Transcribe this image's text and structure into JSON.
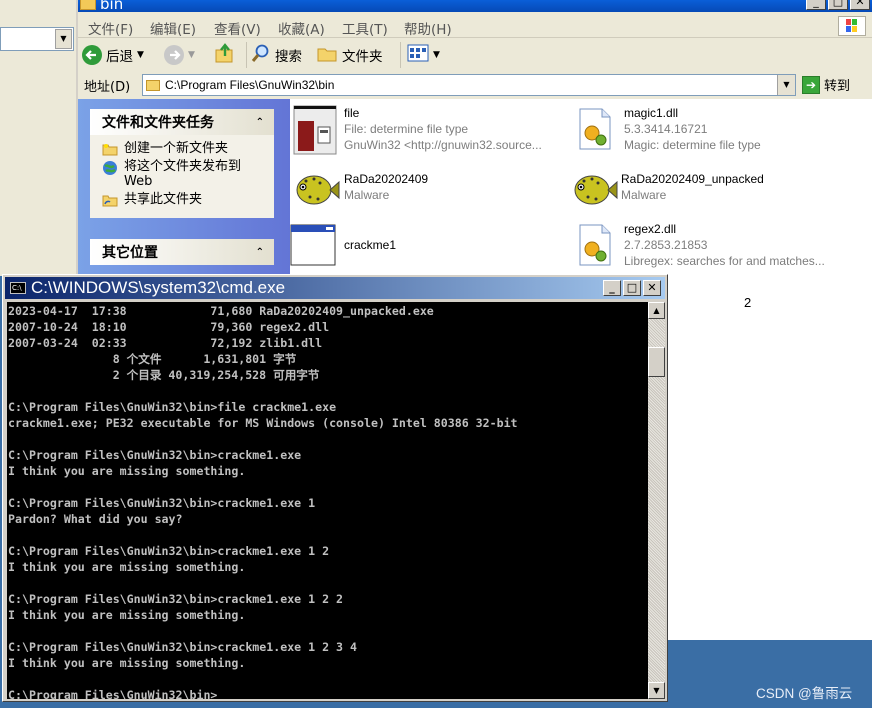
{
  "explorer": {
    "title": "bin",
    "menu": [
      "文件(F)",
      "编辑(E)",
      "查看(V)",
      "收藏(A)",
      "工具(T)",
      "帮助(H)"
    ],
    "toolbar": {
      "back": "后退",
      "search": "搜索",
      "folders": "文件夹"
    },
    "address_label": "地址(D)",
    "address_value": "C:\\Program Files\\GnuWin32\\bin",
    "go_label": "转到",
    "tasks_panel": {
      "title": "文件和文件夹任务",
      "items": [
        "创建一个新文件夹",
        "将这个文件夹发布到 Web",
        "共享此文件夹"
      ]
    },
    "places_panel": {
      "title": "其它位置"
    },
    "files": [
      {
        "name": "file",
        "line2": "File: determine file type",
        "line3": "GnuWin32 <http://gnuwin32.source..."
      },
      {
        "name": "magic1.dll",
        "line2": "5.3.3414.16721",
        "line3": "Magic: determine file type"
      },
      {
        "name": "RaDa20202409",
        "line2": "Malware"
      },
      {
        "name": "RaDa20202409_unpacked",
        "line2": "Malware"
      },
      {
        "name": "crackme1"
      },
      {
        "name": "regex2.dll",
        "line2": "2.7.2853.21853",
        "line3": "Libregex: searches for and matches..."
      }
    ],
    "hidden_fragment": "2"
  },
  "cmd": {
    "title": "C:\\WINDOWS\\system32\\cmd.exe",
    "lines": [
      "2023-04-17  17:38            71,680 RaDa20202409_unpacked.exe",
      "2007-10-24  18:10            79,360 regex2.dll",
      "2007-03-24  02:33            72,192 zlib1.dll",
      "               8 个文件      1,631,801 字节",
      "               2 个目录 40,319,254,528 可用字节",
      "",
      "C:\\Program Files\\GnuWin32\\bin>file crackme1.exe",
      "crackme1.exe; PE32 executable for MS Windows (console) Intel 80386 32-bit",
      "",
      "C:\\Program Files\\GnuWin32\\bin>crackme1.exe",
      "I think you are missing something.",
      "",
      "C:\\Program Files\\GnuWin32\\bin>crackme1.exe 1",
      "Pardon? What did you say?",
      "",
      "C:\\Program Files\\GnuWin32\\bin>crackme1.exe 1 2",
      "I think you are missing something.",
      "",
      "C:\\Program Files\\GnuWin32\\bin>crackme1.exe 1 2 2",
      "I think you are missing something.",
      "",
      "C:\\Program Files\\GnuWin32\\bin>crackme1.exe 1 2 3 4",
      "I think you are missing something.",
      "",
      "C:\\Program Files\\GnuWin32\\bin>_"
    ]
  },
  "watermark": "CSDN @鲁雨云"
}
